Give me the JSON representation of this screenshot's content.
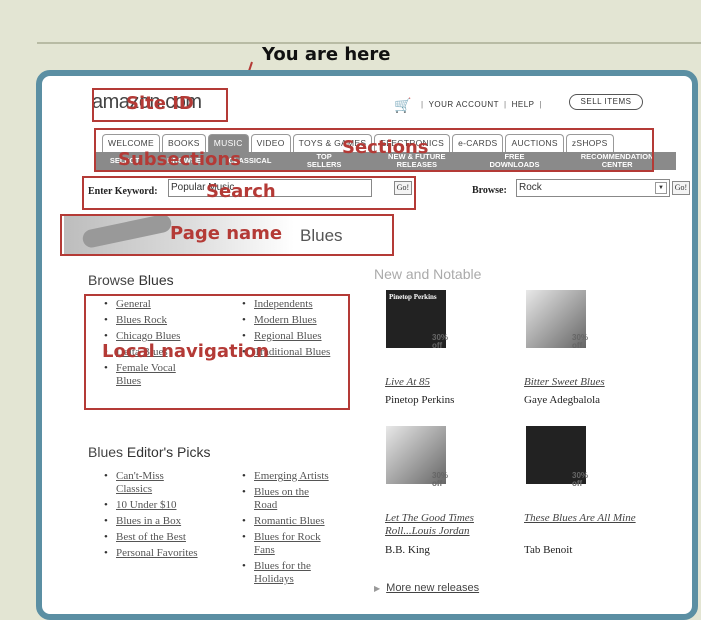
{
  "annotation": {
    "you_are_here": "You are here",
    "labels": {
      "site_id": "Site ID",
      "sections": "Sections",
      "subsections": "Subsections",
      "search": "Search",
      "page_name": "Page name",
      "local_navigation": "Local navigation"
    },
    "color": "#b43a36"
  },
  "header": {
    "logo": "amazon.com",
    "account": "YOUR ACCOUNT",
    "help": "HELP",
    "sell": "SELL ITEMS",
    "cart_icon": "cart-icon"
  },
  "tabs": [
    "WELCOME",
    "BOOKS",
    "MUSIC",
    "VIDEO",
    "TOYS & GAMES",
    "ELECTRONICS",
    "e-CARDS",
    "AUCTIONS",
    "zSHOPS"
  ],
  "active_tab": "MUSIC",
  "subsections": [
    "SELECT",
    "BROWSE",
    "CLASSICAL",
    "TOP SELLERS",
    "NEW & FUTURE RELEASES",
    "FREE DOWNLOADS",
    "RECOMMENDATION CENTER"
  ],
  "search": {
    "label": "Enter Keyword:",
    "value": "Popular Music",
    "go": "Go!",
    "browse_label": "Browse:",
    "browse_value": "Rock",
    "browse_go": "Go!"
  },
  "page_name": "Blues",
  "browse": {
    "heading_prefix": "Browse",
    "heading_bold": "Blues",
    "col1": [
      "General",
      "Blues Rock",
      "Chicago Blues",
      "Delta Blues",
      "Female Vocal Blues"
    ],
    "col2": [
      "Independents",
      "Modern Blues",
      "Regional Blues",
      "Traditional Blues"
    ]
  },
  "picks": {
    "heading_prefix": "Blues",
    "heading_bold": "Editor's Picks",
    "col1": [
      "Can't-Miss Classics",
      "10 Under $10",
      "Blues in a Box",
      "Best of the Best",
      "Personal Favorites"
    ],
    "col2": [
      "Emerging Artists",
      "Blues on the Road",
      "Romantic Blues",
      "Blues for Rock Fans",
      "Blues for the Holidays"
    ]
  },
  "new_notable": {
    "heading": "New and Notable",
    "items": [
      {
        "title": "Live At 85",
        "artist": "Pinetop Perkins",
        "discount": "30%",
        "off": "off",
        "cover_text": "Pinetop Perkins"
      },
      {
        "title": "Bitter Sweet Blues",
        "artist": "Gaye Adegbalola",
        "discount": "30%",
        "off": "off",
        "cover_text": ""
      },
      {
        "title": "Let The Good Times Roll...Louis Jordan",
        "artist": "B.B. King",
        "discount": "30%",
        "off": "off",
        "cover_text": ""
      },
      {
        "title": "These Blues Are All Mine",
        "artist": "Tab Benoit",
        "discount": "30%",
        "off": "off",
        "cover_text": ""
      }
    ],
    "more": "More new releases"
  }
}
